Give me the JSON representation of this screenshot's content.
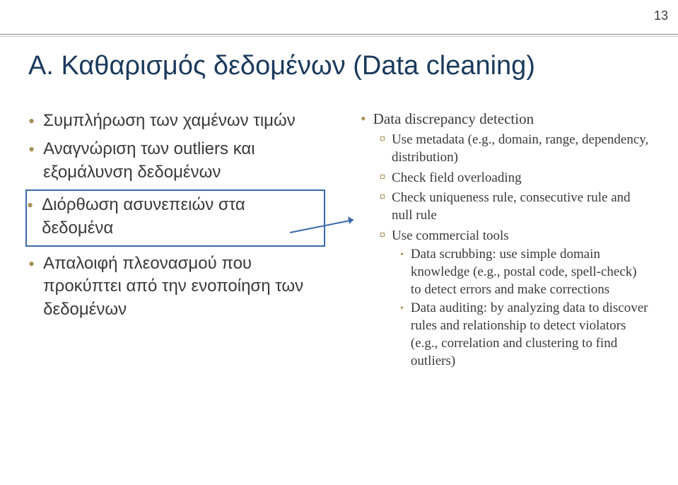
{
  "page_number": "13",
  "title": "A. Καθαρισμός δεδομένων (Data cleaning)",
  "left": {
    "b1": "Συμπλήρωση των χαμένων τιμών",
    "b2": "Αναγνώριση των outliers και εξομάλυνση δεδομένων",
    "b3": "Διόρθωση ασυνεπειών στα δεδομένα",
    "b4": "Απαλοιφή πλεονασμού που προκύπτει από την ενοποίηση των δεδομένων"
  },
  "right": {
    "b1": "Data discrepancy detection",
    "s1": "Use metadata (e.g., domain, range, dependency, distribution)",
    "s2": "Check field overloading",
    "s3": "Check uniqueness rule, consecutive rule and null rule",
    "s4": "Use commercial tools",
    "t1": "Data scrubbing: use simple domain knowledge (e.g., postal code, spell-check) to detect errors and make corrections",
    "t2": "Data auditing: by analyzing data to discover rules and relationship to detect violators (e.g., correlation and clustering to find outliers)"
  }
}
